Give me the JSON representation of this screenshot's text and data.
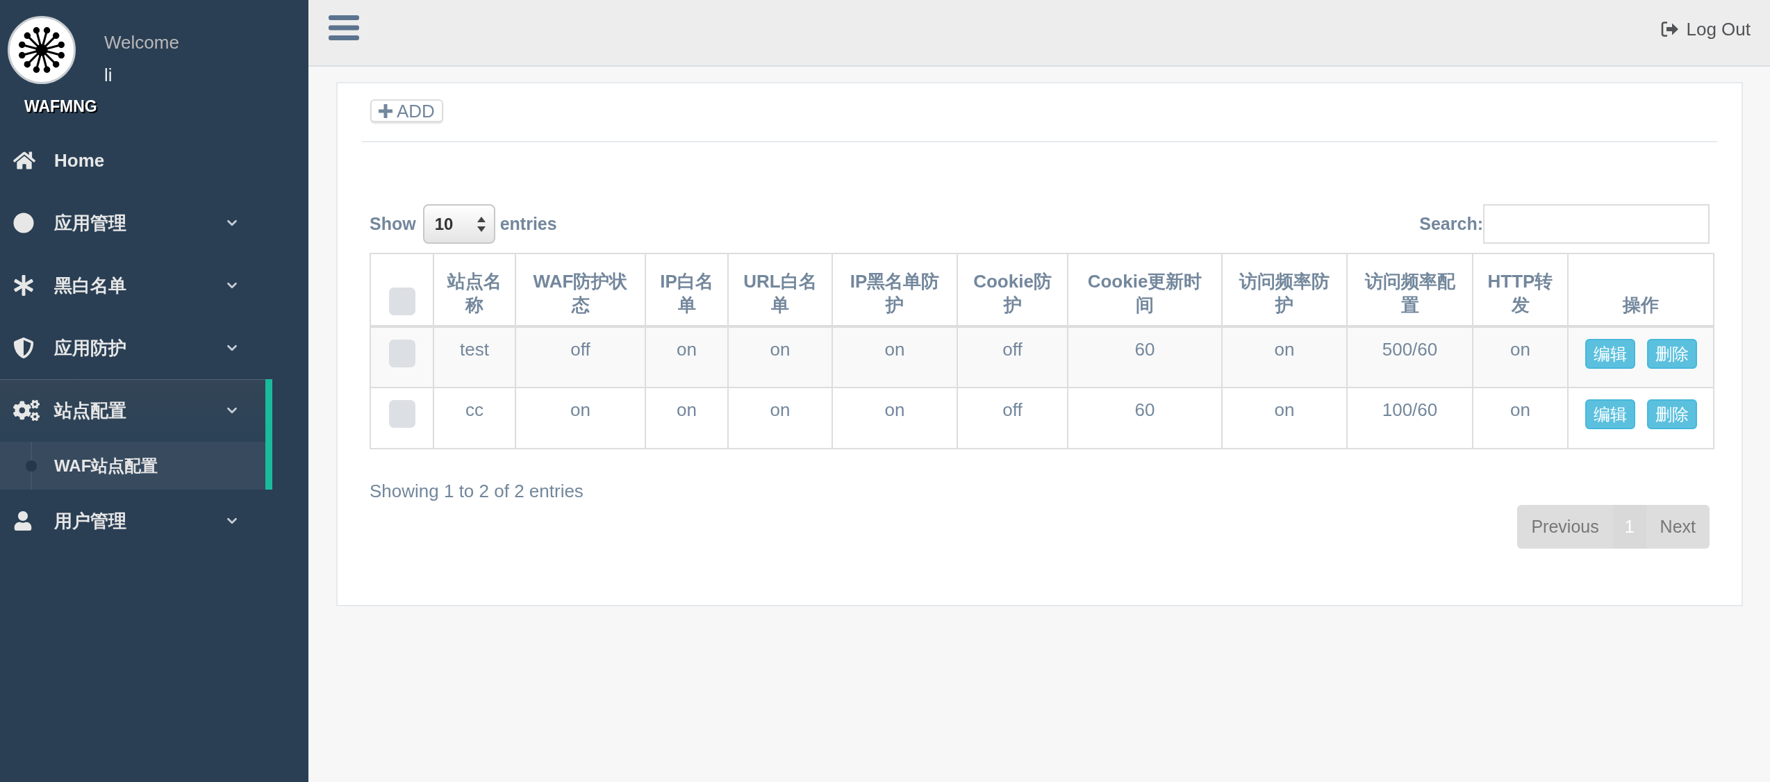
{
  "sidebar": {
    "welcome": "Welcome",
    "username": "li",
    "brand": "WAFMNG",
    "menu": [
      {
        "label": "Home",
        "kind": "link",
        "selected": false
      },
      {
        "label": "应用管理",
        "kind": "group",
        "selected": false
      },
      {
        "label": "黑白名单",
        "kind": "group",
        "selected": false
      },
      {
        "label": "应用防护",
        "kind": "group",
        "selected": false
      },
      {
        "label": "站点配置",
        "kind": "group",
        "selected": true,
        "children": [
          {
            "label": "WAF站点配置",
            "selected": true
          }
        ]
      },
      {
        "label": "用户管理",
        "kind": "group",
        "selected": false
      }
    ]
  },
  "top_bar": {
    "logout": "Log Out"
  },
  "panel": {
    "add_button": "ADD",
    "length": {
      "label": "Show",
      "value": "10",
      "suffix": "entries"
    },
    "search": {
      "label": "Search:"
    },
    "table": {
      "select_all": {
        "checked": false
      },
      "columns": [
        "站点名称",
        "WAF防护状态",
        "IP白名单",
        "URL白名单",
        "IP黑名单防护",
        "Cookie防护",
        "Cookie更新时间",
        "访问频率防护",
        "访问频率配置",
        "HTTP转发",
        "操作"
      ],
      "rows": [
        {
          "checked": false,
          "cells": [
            "test",
            "off",
            "on",
            "on",
            "on",
            "off",
            "60",
            "on",
            "500/60",
            "on"
          ],
          "actions": [
            "编辑",
            "删除"
          ]
        },
        {
          "checked": false,
          "cells": [
            "cc",
            "on",
            "on",
            "on",
            "on",
            "off",
            "60",
            "on",
            "100/60",
            "on"
          ],
          "actions": [
            "编辑",
            "删除"
          ]
        }
      ]
    },
    "info": "Showing 1 to 2 of 2 entries",
    "pagination": {
      "previous": {
        "label": "Previous",
        "disabled": true
      },
      "pages": [
        {
          "label": "1",
          "selected": true
        }
      ],
      "next": {
        "label": "Next",
        "disabled": true
      }
    }
  }
}
